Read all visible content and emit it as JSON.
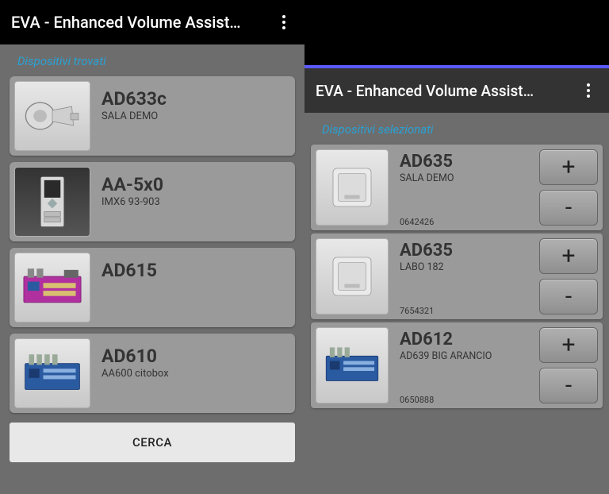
{
  "left": {
    "app_title": "EVA - Enhanced Volume Assist…",
    "section": "Dispositivi trovati",
    "devices": [
      {
        "name": "AD633c",
        "sub": "SALA DEMO",
        "icon": "horn"
      },
      {
        "name": "AA-5x0",
        "sub": "IMX6 93-903",
        "icon": "intercom"
      },
      {
        "name": "AD615",
        "sub": "",
        "icon": "board-pink"
      },
      {
        "name": "AD610",
        "sub": "AA600 citobox",
        "icon": "board-blue"
      }
    ],
    "search_label": "CERCA"
  },
  "right": {
    "app_title": "EVA - Enhanced Volume Assist…",
    "section": "Dispositivi selezionati",
    "devices": [
      {
        "name": "AD635",
        "sub": "SALA DEMO",
        "id": "0642426",
        "icon": "wallbox"
      },
      {
        "name": "AD635",
        "sub": "LABO 182",
        "id": "7654321",
        "icon": "wallbox"
      },
      {
        "name": "AD612",
        "sub": "AD639 BIG ARANCIO",
        "id": "0650888",
        "icon": "board-blue"
      }
    ],
    "plus": "+",
    "minus": "-"
  }
}
